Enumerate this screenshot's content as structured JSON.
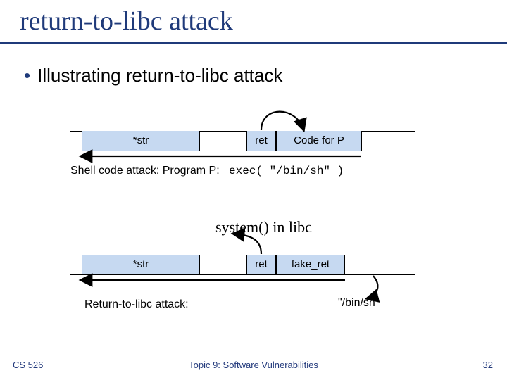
{
  "title": "return-to-libc attack",
  "bullet_text": "Illustrating return-to-libc attack",
  "diagram1": {
    "cells": {
      "str": "*str",
      "ret": "ret",
      "code": "Code for P"
    },
    "caption_prefix": "Shell code attack: Program P:",
    "caption_code": "exec( \"/bin/sh\" )"
  },
  "diagram2": {
    "cells": {
      "str": "*str",
      "ret": "ret",
      "fake_ret": "fake_ret"
    },
    "caption_label": "Return-to-libc attack:",
    "caption_arg": "\"/bin/sh\"",
    "system_label": "system() in libc"
  },
  "footer": {
    "left": "CS 526",
    "center": "Topic 9: Software Vulnerabilities",
    "right": "32"
  }
}
